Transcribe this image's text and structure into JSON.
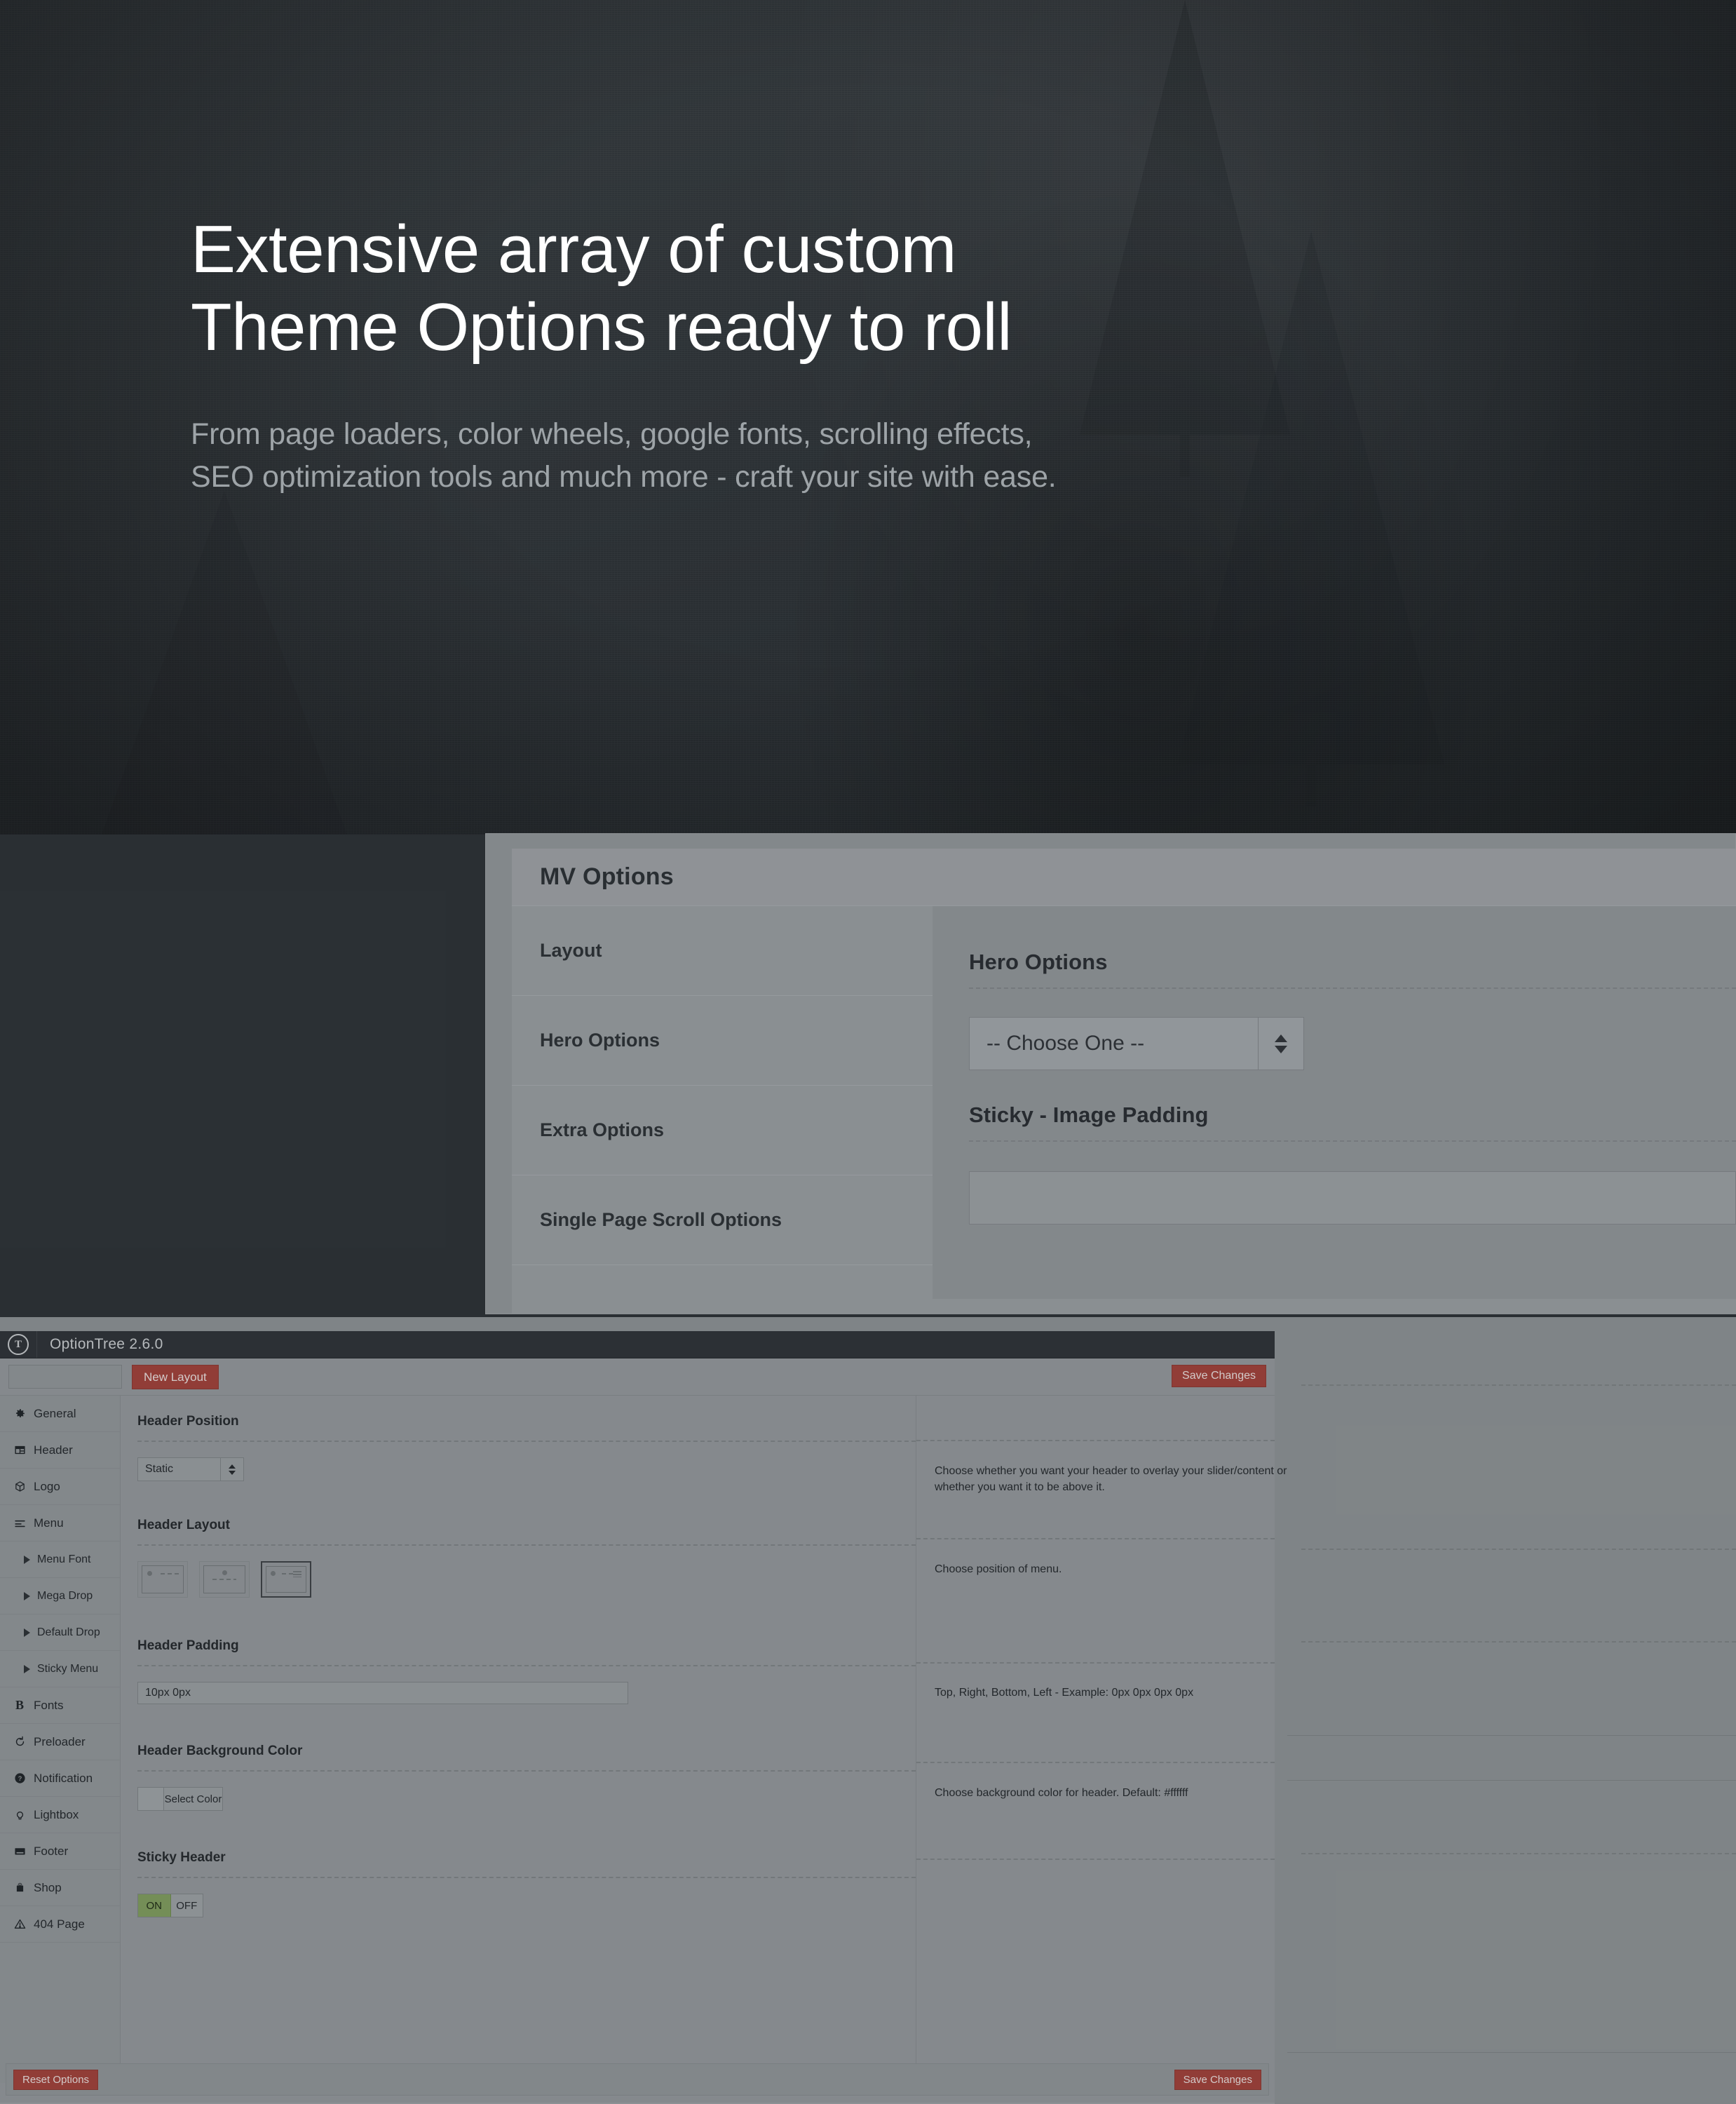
{
  "hero": {
    "title_line1": "Extensive array of custom",
    "title_line2": "Theme Options ready to roll",
    "sub_line1": "From page loaders, color wheels, google fonts, scrolling effects,",
    "sub_line2": "SEO optimization tools and much more - craft your site with ease."
  },
  "mv_options": {
    "panel_title": "MV Options",
    "nav_items": [
      {
        "label": "Layout"
      },
      {
        "label": "Hero Options"
      },
      {
        "label": "Extra Options"
      },
      {
        "label": "Single Page Scroll Options"
      }
    ],
    "sections": [
      {
        "title": "Hero Options",
        "select_value": "-- Choose One --"
      },
      {
        "title": "Sticky - Image Padding",
        "input_value": ""
      }
    ]
  },
  "optiontree": {
    "window_title": "OptionTree 2.6.0",
    "logo_glyph": "T",
    "toolbar": {
      "layout_input_value": "",
      "new_layout_label": "New Layout",
      "save_changes_label": "Save Changes"
    },
    "sidebar": [
      {
        "label": "General",
        "icon": "gear-icon",
        "sub": false
      },
      {
        "label": "Header",
        "icon": "layout-icon",
        "sub": false
      },
      {
        "label": "Logo",
        "icon": "cube-icon",
        "sub": false
      },
      {
        "label": "Menu",
        "icon": "menu-lines-icon",
        "sub": false
      },
      {
        "label": "Menu Font",
        "icon": "caret-right-icon",
        "sub": true
      },
      {
        "label": "Mega Drop",
        "icon": "caret-right-icon",
        "sub": true
      },
      {
        "label": "Default Drop",
        "icon": "caret-right-icon",
        "sub": true
      },
      {
        "label": "Sticky Menu",
        "icon": "caret-right-icon",
        "sub": true
      },
      {
        "label": "Fonts",
        "icon": "bold-b-icon",
        "sub": false
      },
      {
        "label": "Preloader",
        "icon": "refresh-icon",
        "sub": false
      },
      {
        "label": "Notification",
        "icon": "question-circle-icon",
        "sub": false
      },
      {
        "label": "Lightbox",
        "icon": "lightbulb-icon",
        "sub": false
      },
      {
        "label": "Footer",
        "icon": "footer-bar-icon",
        "sub": false
      },
      {
        "label": "Shop",
        "icon": "bag-icon",
        "sub": false
      },
      {
        "label": "404 Page",
        "icon": "warning-triangle-icon",
        "sub": false
      }
    ],
    "fields": [
      {
        "title": "Header Position",
        "control": "select",
        "value": "Static",
        "description": "Choose whether you want your header to overlay your slider/content or whether you want it to be above it."
      },
      {
        "title": "Header Layout",
        "control": "thumbs",
        "description": "Choose position of menu.",
        "thumbs": [
          {
            "name": "logo-left-menu-right",
            "selected": false
          },
          {
            "name": "logo-center-menu-below",
            "selected": false
          },
          {
            "name": "logo-left-menu-burger",
            "selected": true
          }
        ]
      },
      {
        "title": "Header Padding",
        "control": "text",
        "value": "10px 0px",
        "description": "Top, Right, Bottom, Left - Example: 0px 0px 0px 0px"
      },
      {
        "title": "Header Background Color",
        "control": "color",
        "value": "Select Color",
        "description": "Choose background color for header. Default: #ffffff"
      },
      {
        "title": "Sticky Header",
        "control": "onoff",
        "on_label": "ON",
        "off_label": "OFF",
        "value": "ON",
        "description": ""
      }
    ],
    "footer": {
      "reset_label": "Reset Options",
      "save_label": "Save Changes"
    }
  },
  "colors": {
    "accent_red": "#9e4038",
    "toggle_green": "#7d9a5c",
    "titlebar_dark": "#2d3236",
    "hero_bg": "#2d3236",
    "panel_gray": "#909598"
  }
}
